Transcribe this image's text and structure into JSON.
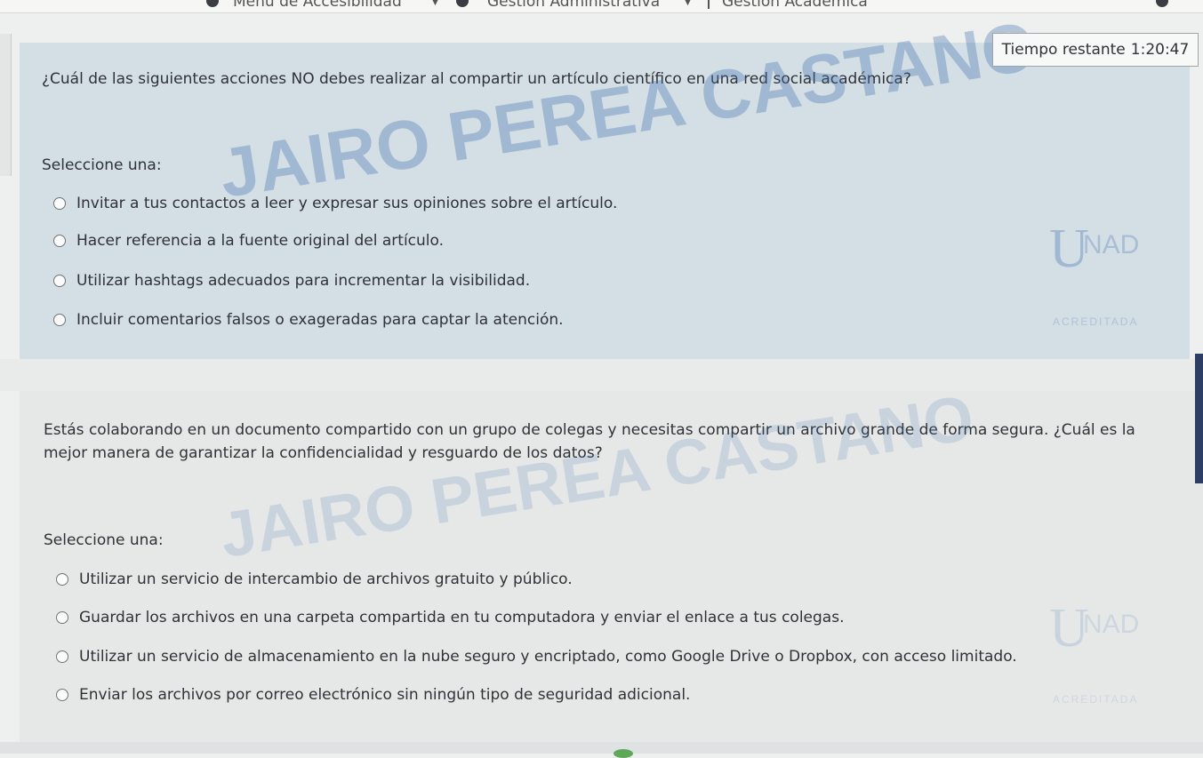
{
  "nav": {
    "accessibility_menu": "Menú de Accesibilidad",
    "administrative": "Gestión Administrativa",
    "academic": "Gestión Académica"
  },
  "timer": {
    "label": "Tiempo restante",
    "value": "1:20:47"
  },
  "question1": {
    "text": "¿Cuál de las siguientes acciones NO debes realizar al compartir un artículo científico en una red social académica?",
    "select_label": "Seleccione una:",
    "options": [
      "Invitar a tus contactos a leer y expresar sus opiniones sobre el artículo.",
      "Hacer referencia a la fuente original del artículo.",
      "Utilizar hashtags adecuados para incrementar la visibilidad.",
      "Incluir comentarios falsos o exageradas para captar la atención."
    ]
  },
  "question2": {
    "text": "Estás colaborando en un documento compartido con un grupo de colegas y necesitas compartir un archivo grande de forma segura. ¿Cuál es la mejor manera de garantizar la confidencialidad y resguardo de los datos?",
    "select_label": "Seleccione una:",
    "options": [
      "Utilizar un servicio de intercambio de archivos gratuito y público.",
      "Guardar los archivos en una carpeta compartida en tu computadora y enviar el enlace a tus colegas.",
      "Utilizar un servicio de almacenamiento en la nube seguro y encriptado, como Google Drive o Dropbox, con acceso limitado.",
      "Enviar los archivos por correo electrónico sin ningún tipo de seguridad adicional."
    ]
  },
  "watermark": {
    "name": "JAIRO PEREA CASTANO",
    "logo_u": "U",
    "logo_nad": "NAD",
    "logo_status": "ACREDITADA"
  },
  "colors": {
    "question_bg": "#d3dee5",
    "question2_bg": "#e6e8e8",
    "text": "#2f3236",
    "watermark": "#4673af"
  }
}
